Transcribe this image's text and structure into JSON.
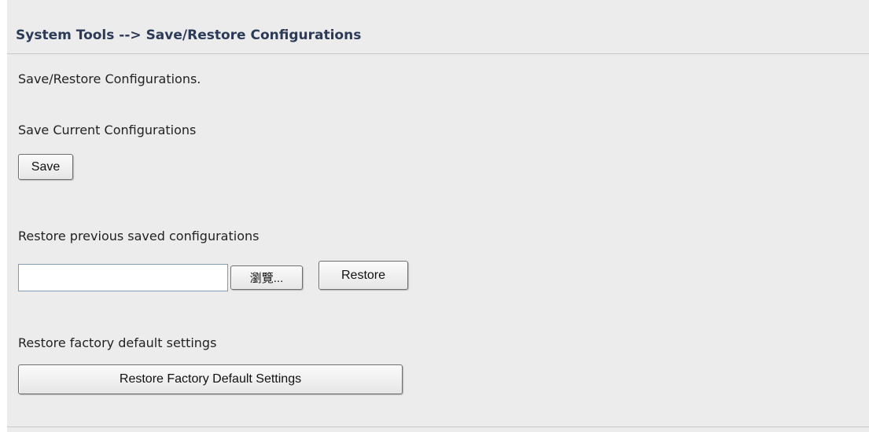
{
  "header": {
    "title": "System Tools --> Save/Restore Configurations"
  },
  "intro": {
    "text": "Save/Restore Configurations."
  },
  "save_section": {
    "heading": "Save Current Configurations",
    "save_label": "Save"
  },
  "restore_section": {
    "heading": "Restore previous saved configurations",
    "file_value": "",
    "browse_label": "瀏覽...",
    "restore_label": "Restore"
  },
  "factory_section": {
    "heading": "Restore factory default settings",
    "button_label": "Restore Factory Default Settings"
  },
  "colors": {
    "background": "#ececec",
    "title_text": "#2b3a57",
    "divider": "#c8c8c8"
  }
}
